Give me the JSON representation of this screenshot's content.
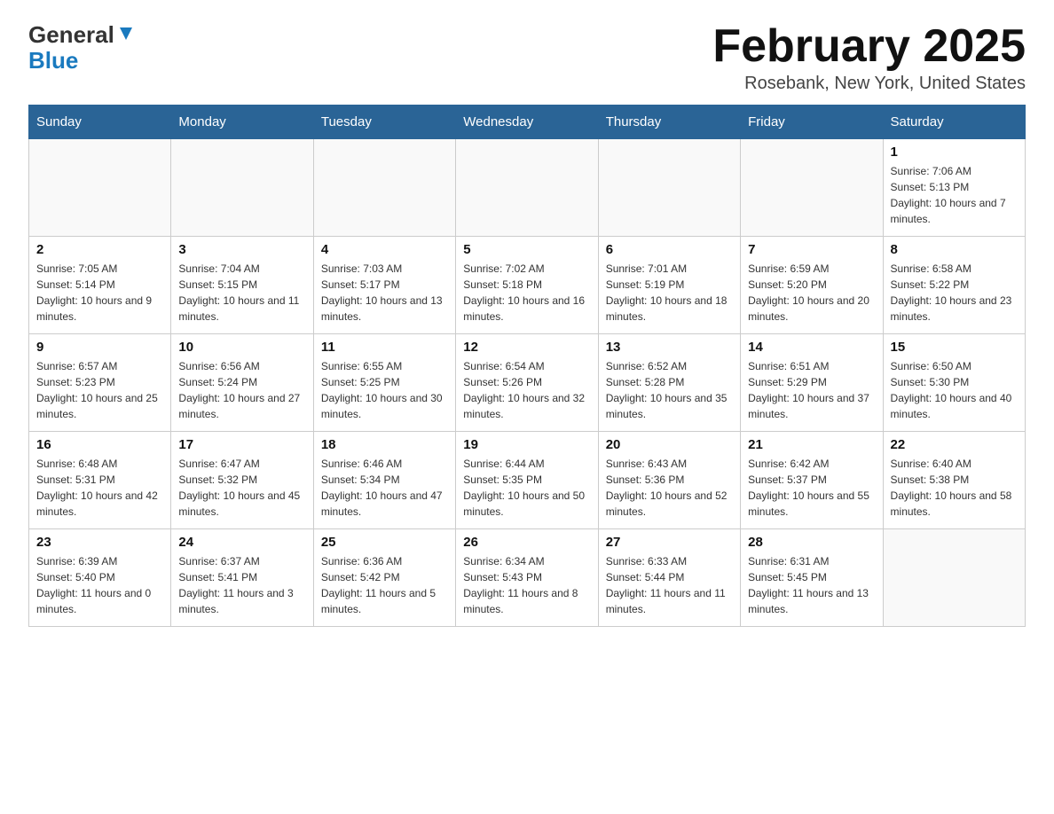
{
  "header": {
    "logo_general": "General",
    "logo_blue": "Blue",
    "month_title": "February 2025",
    "location": "Rosebank, New York, United States"
  },
  "days_of_week": [
    "Sunday",
    "Monday",
    "Tuesday",
    "Wednesday",
    "Thursday",
    "Friday",
    "Saturday"
  ],
  "weeks": [
    [
      {
        "day": "",
        "info": ""
      },
      {
        "day": "",
        "info": ""
      },
      {
        "day": "",
        "info": ""
      },
      {
        "day": "",
        "info": ""
      },
      {
        "day": "",
        "info": ""
      },
      {
        "day": "",
        "info": ""
      },
      {
        "day": "1",
        "info": "Sunrise: 7:06 AM\nSunset: 5:13 PM\nDaylight: 10 hours and 7 minutes."
      }
    ],
    [
      {
        "day": "2",
        "info": "Sunrise: 7:05 AM\nSunset: 5:14 PM\nDaylight: 10 hours and 9 minutes."
      },
      {
        "day": "3",
        "info": "Sunrise: 7:04 AM\nSunset: 5:15 PM\nDaylight: 10 hours and 11 minutes."
      },
      {
        "day": "4",
        "info": "Sunrise: 7:03 AM\nSunset: 5:17 PM\nDaylight: 10 hours and 13 minutes."
      },
      {
        "day": "5",
        "info": "Sunrise: 7:02 AM\nSunset: 5:18 PM\nDaylight: 10 hours and 16 minutes."
      },
      {
        "day": "6",
        "info": "Sunrise: 7:01 AM\nSunset: 5:19 PM\nDaylight: 10 hours and 18 minutes."
      },
      {
        "day": "7",
        "info": "Sunrise: 6:59 AM\nSunset: 5:20 PM\nDaylight: 10 hours and 20 minutes."
      },
      {
        "day": "8",
        "info": "Sunrise: 6:58 AM\nSunset: 5:22 PM\nDaylight: 10 hours and 23 minutes."
      }
    ],
    [
      {
        "day": "9",
        "info": "Sunrise: 6:57 AM\nSunset: 5:23 PM\nDaylight: 10 hours and 25 minutes."
      },
      {
        "day": "10",
        "info": "Sunrise: 6:56 AM\nSunset: 5:24 PM\nDaylight: 10 hours and 27 minutes."
      },
      {
        "day": "11",
        "info": "Sunrise: 6:55 AM\nSunset: 5:25 PM\nDaylight: 10 hours and 30 minutes."
      },
      {
        "day": "12",
        "info": "Sunrise: 6:54 AM\nSunset: 5:26 PM\nDaylight: 10 hours and 32 minutes."
      },
      {
        "day": "13",
        "info": "Sunrise: 6:52 AM\nSunset: 5:28 PM\nDaylight: 10 hours and 35 minutes."
      },
      {
        "day": "14",
        "info": "Sunrise: 6:51 AM\nSunset: 5:29 PM\nDaylight: 10 hours and 37 minutes."
      },
      {
        "day": "15",
        "info": "Sunrise: 6:50 AM\nSunset: 5:30 PM\nDaylight: 10 hours and 40 minutes."
      }
    ],
    [
      {
        "day": "16",
        "info": "Sunrise: 6:48 AM\nSunset: 5:31 PM\nDaylight: 10 hours and 42 minutes."
      },
      {
        "day": "17",
        "info": "Sunrise: 6:47 AM\nSunset: 5:32 PM\nDaylight: 10 hours and 45 minutes."
      },
      {
        "day": "18",
        "info": "Sunrise: 6:46 AM\nSunset: 5:34 PM\nDaylight: 10 hours and 47 minutes."
      },
      {
        "day": "19",
        "info": "Sunrise: 6:44 AM\nSunset: 5:35 PM\nDaylight: 10 hours and 50 minutes."
      },
      {
        "day": "20",
        "info": "Sunrise: 6:43 AM\nSunset: 5:36 PM\nDaylight: 10 hours and 52 minutes."
      },
      {
        "day": "21",
        "info": "Sunrise: 6:42 AM\nSunset: 5:37 PM\nDaylight: 10 hours and 55 minutes."
      },
      {
        "day": "22",
        "info": "Sunrise: 6:40 AM\nSunset: 5:38 PM\nDaylight: 10 hours and 58 minutes."
      }
    ],
    [
      {
        "day": "23",
        "info": "Sunrise: 6:39 AM\nSunset: 5:40 PM\nDaylight: 11 hours and 0 minutes."
      },
      {
        "day": "24",
        "info": "Sunrise: 6:37 AM\nSunset: 5:41 PM\nDaylight: 11 hours and 3 minutes."
      },
      {
        "day": "25",
        "info": "Sunrise: 6:36 AM\nSunset: 5:42 PM\nDaylight: 11 hours and 5 minutes."
      },
      {
        "day": "26",
        "info": "Sunrise: 6:34 AM\nSunset: 5:43 PM\nDaylight: 11 hours and 8 minutes."
      },
      {
        "day": "27",
        "info": "Sunrise: 6:33 AM\nSunset: 5:44 PM\nDaylight: 11 hours and 11 minutes."
      },
      {
        "day": "28",
        "info": "Sunrise: 6:31 AM\nSunset: 5:45 PM\nDaylight: 11 hours and 13 minutes."
      },
      {
        "day": "",
        "info": ""
      }
    ]
  ]
}
